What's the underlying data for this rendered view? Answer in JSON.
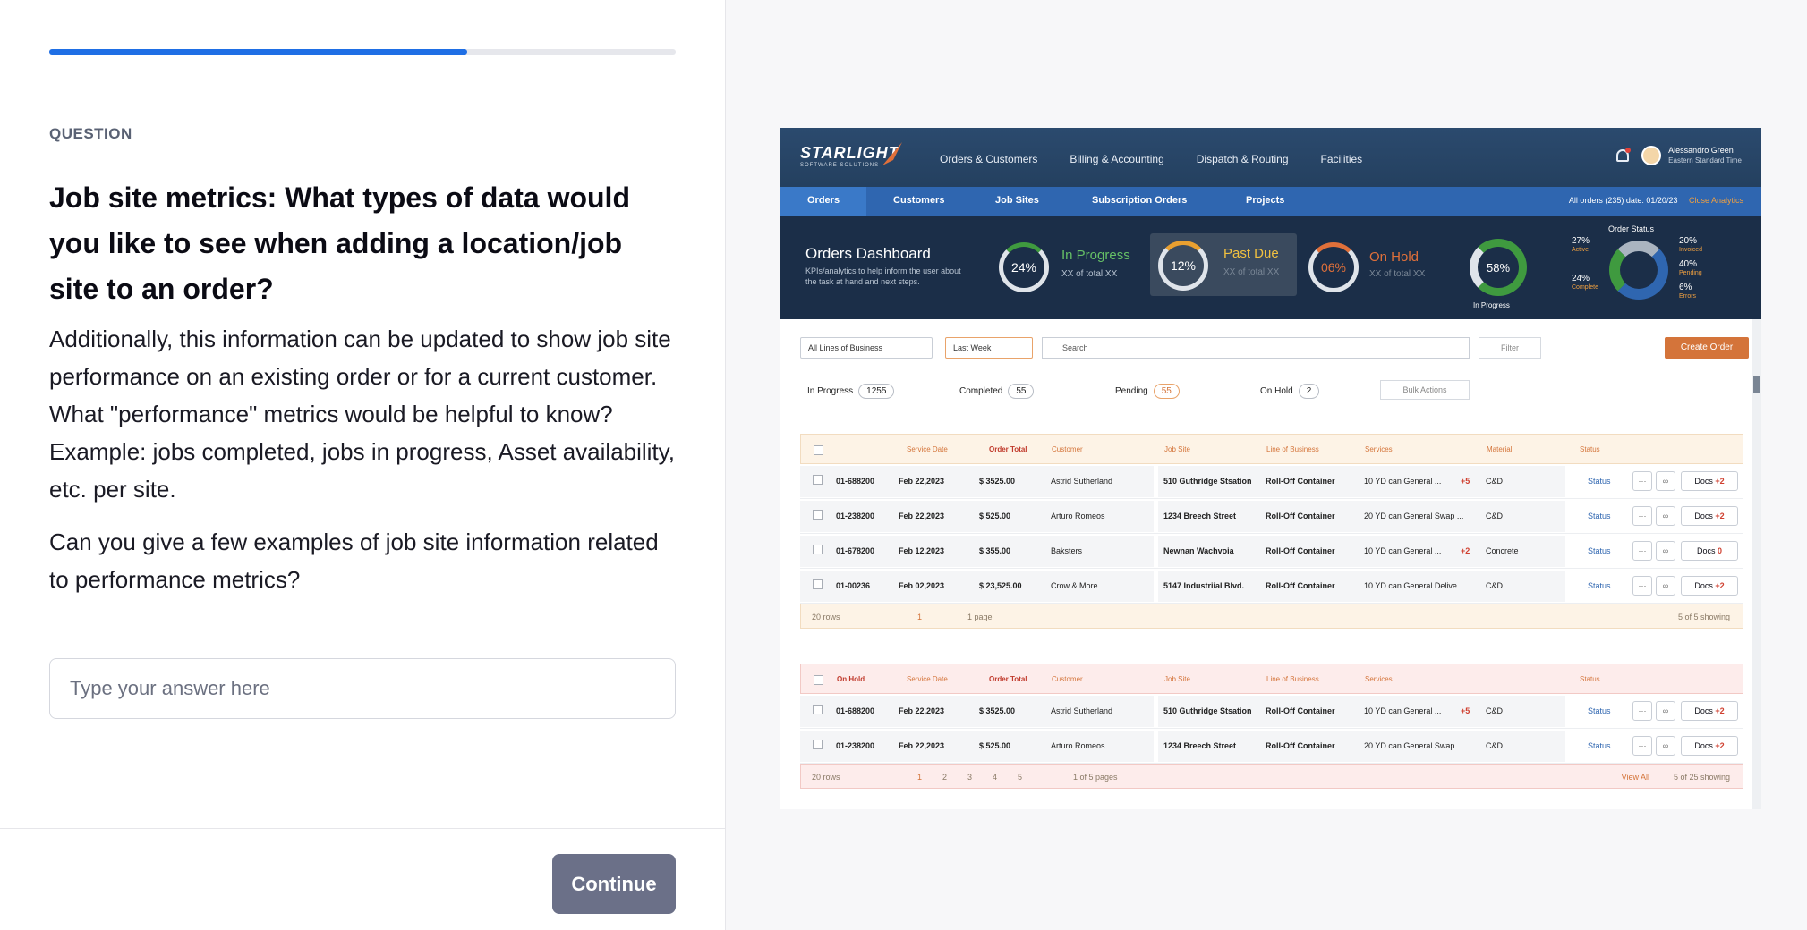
{
  "progress": {
    "fraction": 0.667
  },
  "question": {
    "label": "QUESTION",
    "title": "Job site metrics: What types of data would you like to see when adding a location/job site to an order?",
    "paragraph1": "Additionally, this information can be updated to show job site performance on an existing order or for a current customer. What \"performance\" metrics would be helpful to know? Example: jobs completed, jobs in progress, Asset availability, etc. per site.",
    "paragraph2": "Can you give a few examples of job site information related to performance metrics?",
    "answer_placeholder": "Type your answer here",
    "continue_label": "Continue"
  },
  "screenshot": {
    "logo": {
      "name": "STARLIGHT",
      "tagline": "SOFTWARE SOLUTIONS"
    },
    "topnav": [
      "Orders & Customers",
      "Billing & Accounting",
      "Dispatch & Routing",
      "Facilities"
    ],
    "user": {
      "name": "Alessandro Green",
      "timezone": "Eastern Standard Time"
    },
    "subnav": [
      "Orders",
      "Customers",
      "Job Sites",
      "Subscription Orders",
      "Projects"
    ],
    "date_filter": "All orders (235) date: 01/20/23",
    "close_analytics": "Close Analytics",
    "dashboard": {
      "title": "Orders Dashboard",
      "subtitle": "KPIs/analytics to  help inform the user about the task at hand and next steps.",
      "kpis": [
        {
          "value": "24%",
          "label": "In Progress",
          "sub": "XX of total XX"
        },
        {
          "value": "12%",
          "label": "Past Due",
          "sub": "XX of total XX"
        },
        {
          "value": "06%",
          "label": "On Hold",
          "sub": "XX of total XX"
        }
      ],
      "in_progress_ring": {
        "value": "58%",
        "label": "In Progress"
      },
      "order_status": {
        "title": "Order Status",
        "items": [
          {
            "value": "27%",
            "label": "Active"
          },
          {
            "value": "24%",
            "label": "Complete"
          },
          {
            "value": "20%",
            "label": "Invoiced"
          },
          {
            "value": "40%",
            "label": "Pending"
          },
          {
            "value": "6%",
            "label": "Errors"
          }
        ]
      }
    },
    "toolbar": {
      "lob": "All Lines of Business",
      "period": "Last Week",
      "search": "Search",
      "filter": "Filter",
      "create": "Create Order"
    },
    "status_tabs": [
      {
        "label": "In Progress",
        "count": "1255"
      },
      {
        "label": "Completed",
        "count": "55"
      },
      {
        "label": "Pending",
        "count": "55"
      },
      {
        "label": "On Hold",
        "count": "2"
      }
    ],
    "bulk_actions": "Bulk Actions",
    "columns": [
      "Service Date",
      "Order Total",
      "Customer",
      "Job Site",
      "Line of Business",
      "Services",
      "Material",
      "Status"
    ],
    "table1_rows": [
      [
        "01-688200",
        "Feb 22,2023",
        "$ 3525.00",
        "Astrid Sutherland",
        "510 Guthridge  Stsation",
        "Roll-Off Container",
        "10 YD can General ...",
        "+5",
        "C&D",
        "Status",
        "Docs",
        "+2"
      ],
      [
        "01-238200",
        "Feb 22,2023",
        "$ 525.00",
        "Arturo Romeos",
        "1234 Breech Street",
        "Roll-Off Container",
        "20 YD can General Swap ...",
        "",
        "C&D",
        "Status",
        "Docs",
        "+2"
      ],
      [
        "01-678200",
        "Feb 12,2023",
        "$ 355.00",
        "Baksters",
        "Newnan Wachvoia",
        "Roll-Off Container",
        "10 YD can General ...",
        "+2",
        "Concrete",
        "Status",
        "Docs",
        "0"
      ],
      [
        "01-00236",
        "Feb 02,2023",
        "$ 23,525.00",
        "Crow & More",
        "5147 Industriial Blvd.",
        "Roll-Off Container",
        "10 YD can General Delive...",
        "",
        "C&D",
        "Status",
        "Docs",
        "+2"
      ]
    ],
    "table1_footer": {
      "rows": "20 rows",
      "page": "1",
      "pages": "1 page",
      "showing": "5 of 5 showing"
    },
    "table2_title": "On Hold",
    "table2_rows": [
      [
        "01-688200",
        "Feb 22,2023",
        "$ 3525.00",
        "Astrid Sutherland",
        "510 Guthridge  Stsation",
        "Roll-Off Container",
        "10 YD can General ...",
        "+5",
        "C&D",
        "Status",
        "Docs",
        "+2"
      ],
      [
        "01-238200",
        "Feb 22,2023",
        "$ 525.00",
        "Arturo Romeos",
        "1234 Breech Street",
        "Roll-Off Container",
        "20 YD can General Swap ...",
        "",
        "C&D",
        "Status",
        "Docs",
        "+2"
      ]
    ],
    "table2_footer": {
      "rows": "20 rows",
      "pages_list": [
        "1",
        "2",
        "3",
        "4",
        "5"
      ],
      "pages": "1 of 5 pages",
      "view_all": "View All",
      "showing": "5 of 25 showing"
    }
  },
  "colors": {
    "accent": "#1f6fe5",
    "button": "#6b7088",
    "orange": "#d4743a"
  }
}
